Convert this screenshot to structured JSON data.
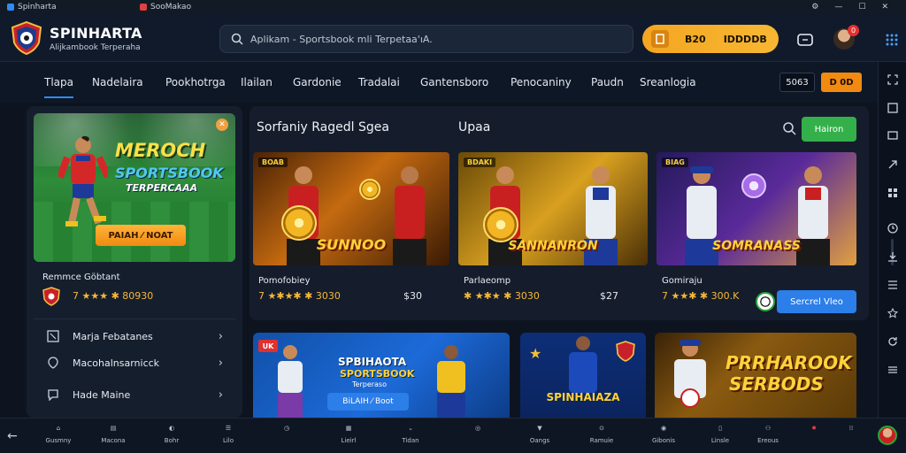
{
  "os": {
    "tab1": "Spinharta",
    "tab2": "SooMakao"
  },
  "header": {
    "brand": "SPINHARTA",
    "tagline": "Alijkambook Terperaha",
    "search_placeholder": "Aplikam - Sportsbook mli Terpetaa'ıA.",
    "wallet_balance": "B20",
    "wallet_currency": "IDDDDB",
    "notification_count": "0"
  },
  "nav": {
    "items": [
      "Tlapa",
      "Nadelaira",
      "Pookhotrga",
      "Ilailan",
      "Gardonie",
      "Tradalai",
      "Gantensboro",
      "Penocaniny",
      "Paudn",
      "Sreanlogia"
    ],
    "code_label": "5063",
    "orange_label": "D 0D"
  },
  "promo": {
    "title1": "MEROCH",
    "title2": "SPORTSBOOK",
    "title3": "TERPERCAAA",
    "cta": "PAIAH ⁄ NOAT"
  },
  "left_panel": {
    "subtitle": "Remmce Göbtant",
    "rating": "7 ★★★ ✱ 80930",
    "menu": [
      {
        "label": "Marja Febatanes"
      },
      {
        "label": "Macohalnsarnicck"
      },
      {
        "label": "Hade Maine"
      }
    ]
  },
  "main": {
    "section_title": "Sorfaniy Ragedl Sgea",
    "section_title2": "Upaa",
    "top_button": "Hairon",
    "cards": [
      {
        "tag": "BOAB",
        "label": "SUNNOO",
        "name": "Pomofobiey",
        "stars": "7 ★✱★✱ ✱ 3030",
        "price": "$30"
      },
      {
        "tag": "BDAKI",
        "label": "SANNANRON",
        "name": "Parlaeomp",
        "stars": "✱ ★✱★ ✱ 3030",
        "price": "$27"
      },
      {
        "tag": "BIAG",
        "label": "SOMRANASS",
        "name": "Gomiraju",
        "stars": "7 ★★✱ ✱ 300.K",
        "price": ""
      }
    ],
    "sv_button": "Sercrel Vleo"
  },
  "banners": {
    "b1_title": "SPBIHAOTA",
    "b1_sub": "SPORTSBOOK",
    "b1_sub2": "Terperaso",
    "b1_cta": "BiLAIH ⁄ Boot",
    "b1_tag": "UK",
    "b2_title": "SPINHAIAZA",
    "b3_title1": "PRRHAROOK",
    "b3_title2": "SERBODS"
  },
  "bottom": {
    "items": [
      "Gusmny",
      "Macona",
      "Bohr",
      "Lilo",
      "",
      "Lieirl",
      "Tidan",
      "",
      "Oangs",
      "Ramuie",
      "Gibonis",
      "Linsle",
      "Ereous",
      "",
      ""
    ]
  },
  "colors": {
    "accent_blue": "#2f8cf0",
    "wallet_orange": "#f4a621",
    "green_button": "#34b04a",
    "blue_button": "#2c7ee8"
  }
}
